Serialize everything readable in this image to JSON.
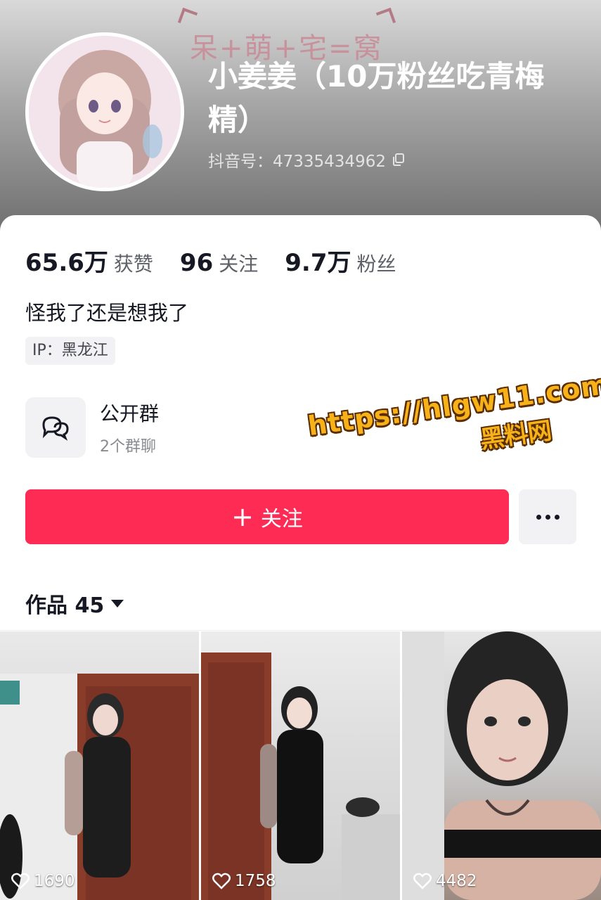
{
  "profile": {
    "banner_text": "呆+萌+宅=窝",
    "nickname": "小姜姜（10万粉丝吃青梅精）",
    "douyin_id": "抖音号：47335434962"
  },
  "stats": [
    {
      "value": "65.6万",
      "label": "获赞"
    },
    {
      "value": "96",
      "label": "关注"
    },
    {
      "value": "9.7万",
      "label": "粉丝"
    }
  ],
  "bio": "怪我了还是想我了",
  "ip": "IP：黑龙江",
  "group": {
    "title": "公开群",
    "subtitle": "2个群聊"
  },
  "watermark": {
    "url": "https://hlgw11.com",
    "name": "黑料网"
  },
  "actions": {
    "follow_plus": "+",
    "follow_label": "关注"
  },
  "works_tab": {
    "label": "作品 45"
  },
  "videos": [
    {
      "likes": "1690"
    },
    {
      "likes": "1758"
    },
    {
      "likes": "4482"
    }
  ],
  "colors": {
    "accent": "#fe2c55",
    "watermark": "#f7b21a"
  }
}
